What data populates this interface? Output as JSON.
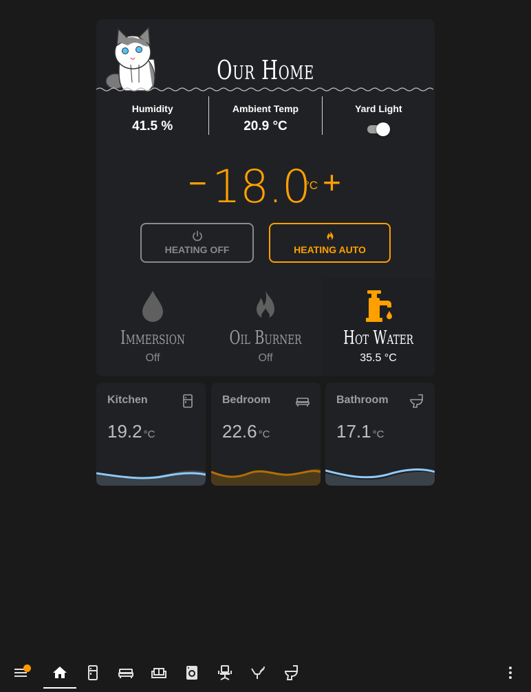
{
  "header": {
    "title": "Our Home"
  },
  "stats": [
    {
      "label": "Humidity",
      "value": "41.5 %"
    },
    {
      "label": "Ambient Temp",
      "value": "20.9 °C"
    },
    {
      "label": "Yard Light",
      "toggle": "on"
    }
  ],
  "thermostat": {
    "minus": "−",
    "target": "18.0",
    "unit": "°C",
    "plus": "+"
  },
  "modes": {
    "off": {
      "label": "HEATING OFF",
      "icon": "power-icon"
    },
    "auto": {
      "label": "HEATING AUTO",
      "icon": "flame-icon",
      "active": true
    }
  },
  "devices": [
    {
      "name": "Immersion",
      "state": "Off",
      "icon": "water-drop-icon"
    },
    {
      "name": "Oil Burner",
      "state": "Off",
      "icon": "fire-icon"
    },
    {
      "name": "Hot Water",
      "state": "35.5 °C",
      "icon": "faucet-icon",
      "active": true
    }
  ],
  "rooms": [
    {
      "name": "Kitchen",
      "temp": "19.2",
      "unit": "°C",
      "icon": "fridge-icon"
    },
    {
      "name": "Bedroom",
      "temp": "22.6",
      "unit": "°C",
      "icon": "bed-icon"
    },
    {
      "name": "Bathroom",
      "temp": "17.1",
      "unit": "°C",
      "icon": "toilet-icon"
    }
  ],
  "colors": {
    "accent": "#ffa000",
    "card": "#202124",
    "background": "#1a1a1a",
    "cool_wave": "#90caf9"
  },
  "nav": [
    "menu-icon",
    "home-icon",
    "fridge-icon",
    "bed-icon",
    "sofa-icon",
    "washing-machine-icon",
    "office-chair-icon",
    "shower-icon",
    "toilet-icon",
    "more-vertical-icon"
  ]
}
